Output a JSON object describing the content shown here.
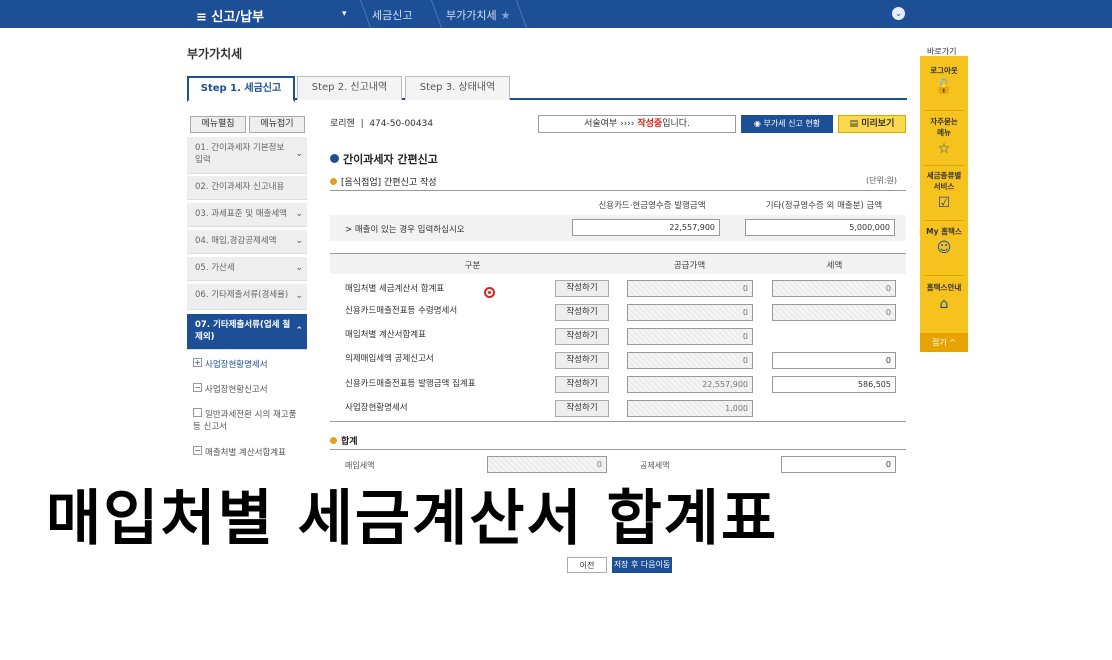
{
  "topbar": {
    "menu_label": "≡ 신고/납부",
    "caret": "▾",
    "crumb1": "세금신고",
    "crumb2": "부가가치세",
    "star": "★",
    "down": "⌄"
  },
  "page_title": "부가가치세",
  "tabs": [
    "Step 1. 세금신고",
    "Step 2. 신고내역",
    "Step 3. 상태내역"
  ],
  "left": {
    "btn_expand": "메뉴펼침",
    "btn_collapse": "메뉴접기",
    "items": [
      "01. 간이과세자 기본정보 입력",
      "02. 간이과세자 신고내용",
      "03. 과세표준 및 매출세액",
      "04. 매입,경감공제세액",
      "05. 가산세",
      "06. 기타제출서류(경세율)",
      "07. 기타제출서류(업세 철제외)"
    ],
    "subs": [
      {
        "box": "+",
        "label": "사업장현황명세서"
      },
      {
        "box": "−",
        "label": "사업장현황신고서"
      },
      {
        "box": "",
        "label": "일반과세전환 시의 재고품등 신고서"
      },
      {
        "box": "−",
        "label": "매출처별 계산서합계표"
      }
    ],
    "chev": "⌄",
    "chev_up": "⌃"
  },
  "info": {
    "label": "로리헨",
    "bizno": "474-50-00434",
    "status_prefix": "서술여부 ›››› ",
    "status_red": "작성중",
    "status_suffix": "입니다.",
    "btn_vat": "부가세 신고 현황",
    "btn_preview": "미리보기"
  },
  "section": {
    "title": "간이과세자 간편신고",
    "subtitle": "[음식점업] 간편신고 작성",
    "unit": "(단위:원)"
  },
  "sales": {
    "col1": "신용카드·현금영수증 발행금액",
    "col2": "기타(정규영수증 외 매출분) 금액",
    "row_label": "> 매출이 있는 경우 입력하십시오",
    "val1": "22,557,900",
    "val2": "5,000,000"
  },
  "table": {
    "headers": [
      "구분",
      "공급가액",
      "세액"
    ],
    "write_label": "작성하기",
    "rows": [
      {
        "label": "매입처별 세금계산서 합계표",
        "supply": "0",
        "tax": "0"
      },
      {
        "label": "신용카드매출전표등 수령명세서",
        "supply": "0",
        "tax": "0"
      },
      {
        "label": "매입처별 계산서합계표",
        "supply": "0",
        "tax": ""
      },
      {
        "label": "의제매입세액 공제신고서",
        "supply": "0",
        "tax": "0"
      },
      {
        "label": "신용카드매출전표등 발행금액 집계표",
        "supply": "22,557,900",
        "tax": "586,505"
      },
      {
        "label": "사업장현황명세서",
        "supply": "1,000",
        "tax": ""
      }
    ]
  },
  "total": {
    "title": "합계",
    "label1": "매입세액",
    "val1": "0",
    "label2": "공제세액",
    "val2": "0"
  },
  "caption": "매입처별 세금계산서 합계표",
  "bottom": {
    "btn1": "이전",
    "btn2": "저장 후 다음이동"
  },
  "quick": {
    "title": "바로가기",
    "items": [
      {
        "label": "로그아웃",
        "icon": "🔓"
      },
      {
        "label": "자주묻는 메뉴",
        "icon": "☆"
      },
      {
        "label": "세금종류별 서비스",
        "icon": "☑"
      },
      {
        "label": "My 홈택스",
        "icon": "☺"
      },
      {
        "label": "홈택스안내",
        "icon": "⌂"
      }
    ],
    "close": "접기 ^"
  }
}
